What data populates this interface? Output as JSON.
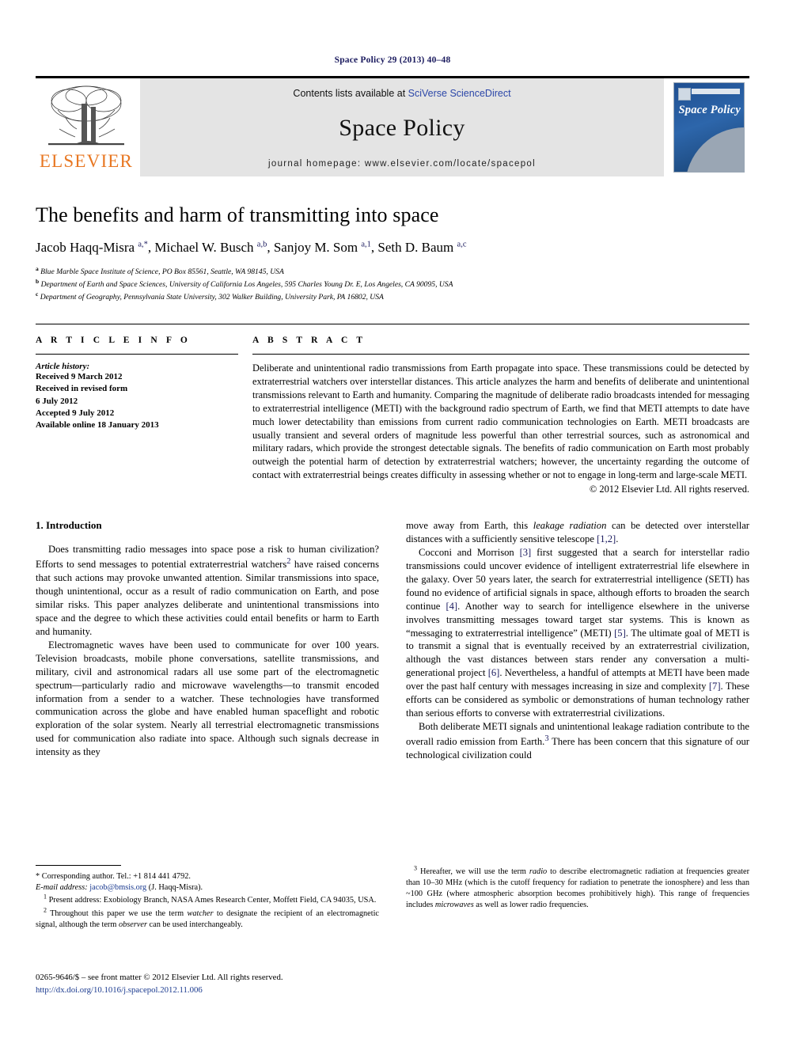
{
  "running_head": "Space Policy 29 (2013) 40–48",
  "masthead": {
    "publisher_name": "ELSEVIER",
    "contents_prefix": "Contents lists available at ",
    "contents_link": "SciVerse ScienceDirect",
    "journal_name": "Space Policy",
    "homepage": "journal homepage: www.elsevier.com/locate/spacepol",
    "cover_title": "Space Policy"
  },
  "article": {
    "title": "The benefits and harm of transmitting into space",
    "authors": "Jacob Haqq-Misra a,*, Michael W. Busch a,b, Sanjoy M. Som a,1, Seth D. Baum a,c",
    "affiliations": [
      "a Blue Marble Space Institute of Science, PO Box 85561, Seattle, WA 98145, USA",
      "b Department of Earth and Space Sciences, University of California Los Angeles, 595 Charles Young Dr. E, Los Angeles, CA 90095, USA",
      "c Department of Geography, Pennsylvania State University, 302 Walker Building, University Park, PA 16802, USA"
    ]
  },
  "info": {
    "heading": "A R T I C L E   I N F O",
    "history_label": "Article history:",
    "history": [
      "Received 9 March 2012",
      "Received in revised form",
      "6 July 2012",
      "Accepted 9 July 2012",
      "Available online 18 January 2013"
    ]
  },
  "abstract": {
    "heading": "A B S T R A C T",
    "text": "Deliberate and unintentional radio transmissions from Earth propagate into space. These transmissions could be detected by extraterrestrial watchers over interstellar distances. This article analyzes the harm and benefits of deliberate and unintentional transmissions relevant to Earth and humanity. Comparing the magnitude of deliberate radio broadcasts intended for messaging to extraterrestrial intelligence (METI) with the background radio spectrum of Earth, we find that METI attempts to date have much lower detectability than emissions from current radio communication technologies on Earth. METI broadcasts are usually transient and several orders of magnitude less powerful than other terrestrial sources, such as astronomical and military radars, which provide the strongest detectable signals. The benefits of radio communication on Earth most probably outweigh the potential harm of detection by extraterrestrial watchers; however, the uncertainty regarding the outcome of contact with extraterrestrial beings creates difficulty in assessing whether or not to engage in long-term and large-scale METI.",
    "copyright": "© 2012 Elsevier Ltd. All rights reserved."
  },
  "body": {
    "section_title": "1. Introduction",
    "left_paragraphs": [
      "Does transmitting radio messages into space pose a risk to human civilization? Efforts to send messages to potential extraterrestrial watchers² have raised concerns that such actions may provoke unwanted attention. Similar transmissions into space, though unintentional, occur as a result of radio communication on Earth, and pose similar risks. This paper analyzes deliberate and unintentional transmissions into space and the degree to which these activities could entail benefits or harm to Earth and humanity.",
      "Electromagnetic waves have been used to communicate for over 100 years. Television broadcasts, mobile phone conversations, satellite transmissions, and military, civil and astronomical radars all use some part of the electromagnetic spectrum—particularly radio and microwave wavelengths—to transmit encoded information from a sender to a watcher. These technologies have transformed communication across the globe and have enabled human spaceflight and robotic exploration of the solar system. Nearly all terrestrial electromagnetic transmissions used for communication also radiate into space. Although such signals decrease in intensity as they"
    ],
    "right_paragraphs": [
      "move away from Earth, this leakage radiation can be detected over interstellar distances with a sufficiently sensitive telescope [1,2].",
      "Cocconi and Morrison [3] first suggested that a search for interstellar radio transmissions could uncover evidence of intelligent extraterrestrial life elsewhere in the galaxy. Over 50 years later, the search for extraterrestrial intelligence (SETI) has found no evidence of artificial signals in space, although efforts to broaden the search continue [4]. Another way to search for intelligence elsewhere in the universe involves transmitting messages toward target star systems. This is known as “messaging to extraterrestrial intelligence” (METI) [5]. The ultimate goal of METI is to transmit a signal that is eventually received by an extraterrestrial civilization, although the vast distances between stars render any conversation a multi-generational project [6]. Nevertheless, a handful of attempts at METI have been made over the past half century with messages increasing in size and complexity [7]. These efforts can be considered as symbolic or demonstrations of human technology rather than serious efforts to converse with extraterrestrial civilizations.",
      "Both deliberate METI signals and unintentional leakage radiation contribute to the overall radio emission from Earth.³ There has been concern that this signature of our technological civilization could"
    ]
  },
  "footnotes": {
    "corresponding": "* Corresponding author. Tel.: +1 814 441 4792.",
    "email_label": "E-mail address:",
    "email": "jacob@bmsis.org",
    "email_suffix": "(J. Haqq-Misra).",
    "note1": "1 Present address: Exobiology Branch, NASA Ames Research Center, Moffett Field, CA 94035, USA.",
    "note2": "2 Throughout this paper we use the term watcher to designate the recipient of an electromagnetic signal, although the term observer can be used interchangeably.",
    "note3": "3 Hereafter, we will use the term radio to describe electromagnetic radiation at frequencies greater than 10–30 MHz (which is the cutoff frequency for radiation to penetrate the ionosphere) and less than ~100 GHz (where atmospheric absorption becomes prohibitively high). This range of frequencies includes microwaves as well as lower radio frequencies."
  },
  "imprint": {
    "line": "0265-9646/$ – see front matter © 2012 Elsevier Ltd. All rights reserved.",
    "doi": "http://dx.doi.org/10.1016/j.spacepol.2012.11.006"
  }
}
